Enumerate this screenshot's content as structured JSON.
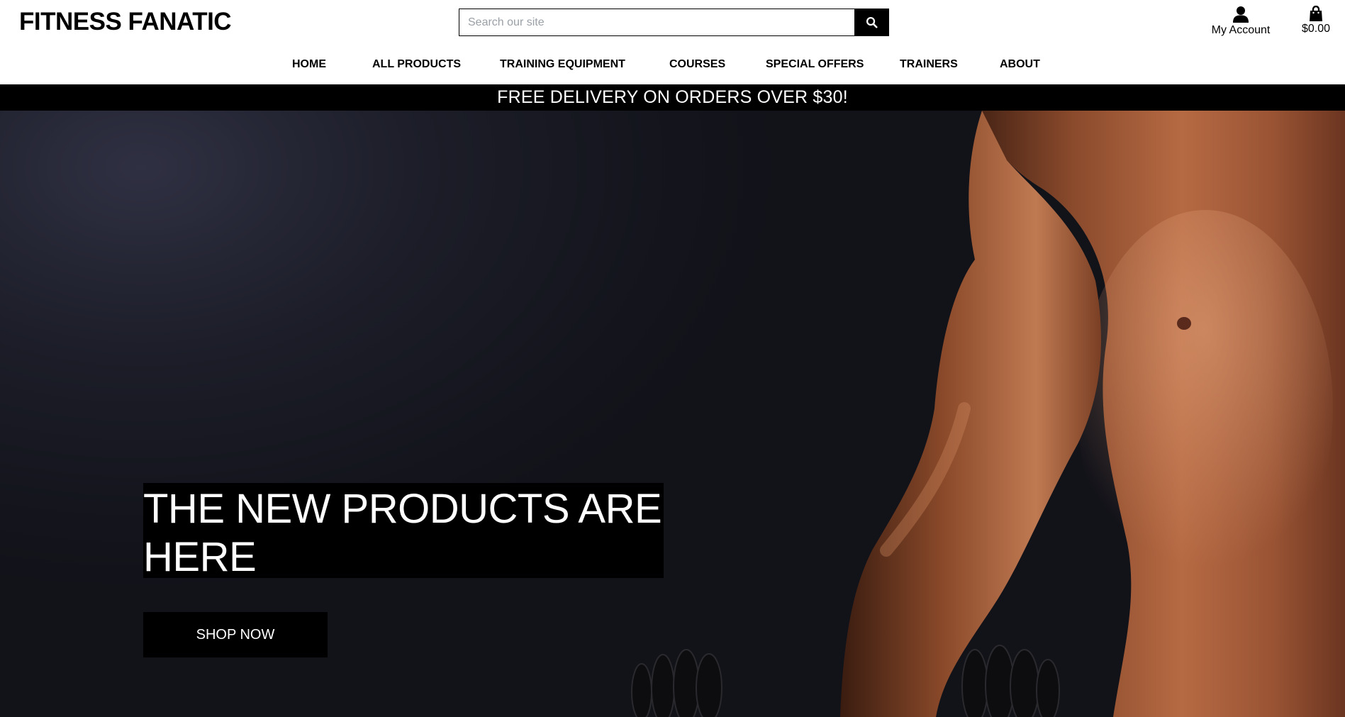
{
  "header": {
    "logo": "FITNESS FANATIC",
    "search": {
      "placeholder": "Search our site",
      "value": "",
      "button_icon": "search-icon"
    },
    "account": {
      "label": "My Account",
      "icon": "user-icon"
    },
    "bag": {
      "label": "$0.00",
      "icon": "shopping-bag-icon"
    }
  },
  "nav": {
    "items": [
      {
        "label": "HOME"
      },
      {
        "label": "ALL PRODUCTS"
      },
      {
        "label": "TRAINING EQUIPMENT"
      },
      {
        "label": "COURSES"
      },
      {
        "label": "SPECIAL OFFERS"
      },
      {
        "label": "TRAINERS"
      },
      {
        "label": "ABOUT"
      }
    ]
  },
  "banner": {
    "text": "FREE DELIVERY ON ORDERS OVER $30!"
  },
  "hero": {
    "headline": "THE NEW PRODUCTS ARE HERE",
    "cta_label": "SHOP NOW"
  },
  "colors": {
    "background": "#ffffff",
    "banner_bg": "#000000",
    "hero_bg": "#1c1d28",
    "text_light": "#ffffff",
    "accent": "#000000"
  }
}
